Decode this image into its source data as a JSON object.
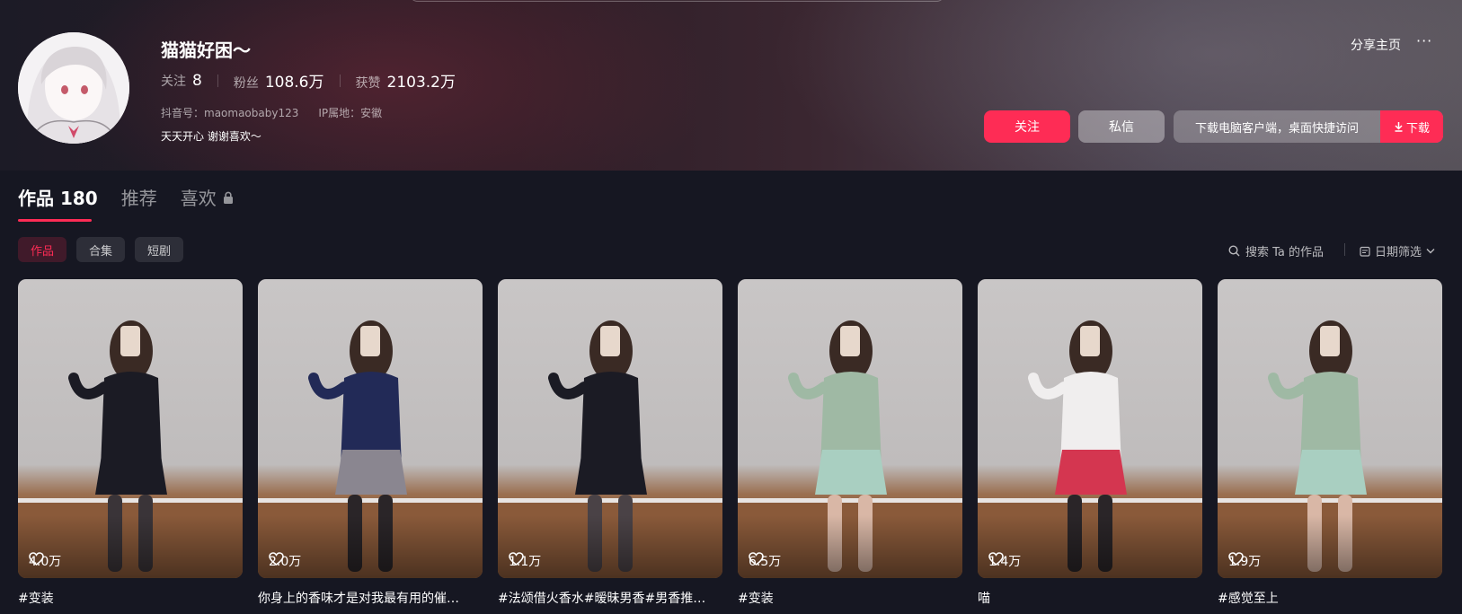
{
  "profile": {
    "nickname": "猫猫好困～",
    "following_label": "关注",
    "following_count": "8",
    "followers_label": "粉丝",
    "followers_count": "108.6万",
    "likes_label": "获赞",
    "likes_count": "2103.2万",
    "douyin_id": "抖音号：maomaobaby123",
    "ip_location": "IP属地：安徽",
    "bio": "天天开心 谢谢喜欢～"
  },
  "actions": {
    "share": "分享主页",
    "more": "···",
    "follow": "关注",
    "message": "私信",
    "download_prompt": "下载电脑客户端，桌面快捷访问",
    "download": "下载"
  },
  "tabs": [
    {
      "label": "作品 180",
      "active": true
    },
    {
      "label": "推荐",
      "active": false
    },
    {
      "label": "喜欢",
      "active": false,
      "locked": true
    }
  ],
  "chips": [
    {
      "label": "作品",
      "active": true
    },
    {
      "label": "合集",
      "active": false
    },
    {
      "label": "短剧",
      "active": false
    }
  ],
  "search_works": "搜索 Ta 的作品",
  "date_filter": "日期筛选",
  "videos": [
    {
      "likes": "4.0万",
      "caption": "#变装",
      "outfit": "#1b1b24",
      "skirt": "#1b1b24",
      "legs": "#3a3438"
    },
    {
      "likes": "2.0万",
      "caption": "你身上的香味才是对我最有用的催…",
      "outfit": "#222a57",
      "skirt": "#8a8690",
      "legs": "#2a2528"
    },
    {
      "likes": "1.1万",
      "caption": "#法颂借火香水#暧昧男香#男香推…",
      "outfit": "#1b1b24",
      "skirt": "#1b1b24",
      "legs": "#4a4246"
    },
    {
      "likes": "6.5万",
      "caption": "#变装",
      "outfit": "#9fb9a4",
      "skirt": "#a9cfc1",
      "legs": "#d9b7a6"
    },
    {
      "likes": "1.4万",
      "caption": "喵",
      "outfit": "#f0eeee",
      "skirt": "#d43650",
      "legs": "#2a2528"
    },
    {
      "likes": "1.9万",
      "caption": "#感觉至上",
      "outfit": "#9fb9a4",
      "skirt": "#a9cfc1",
      "legs": "#d9b7a6"
    }
  ],
  "colors": {
    "accent": "#fe2c55",
    "background": "#161722"
  }
}
